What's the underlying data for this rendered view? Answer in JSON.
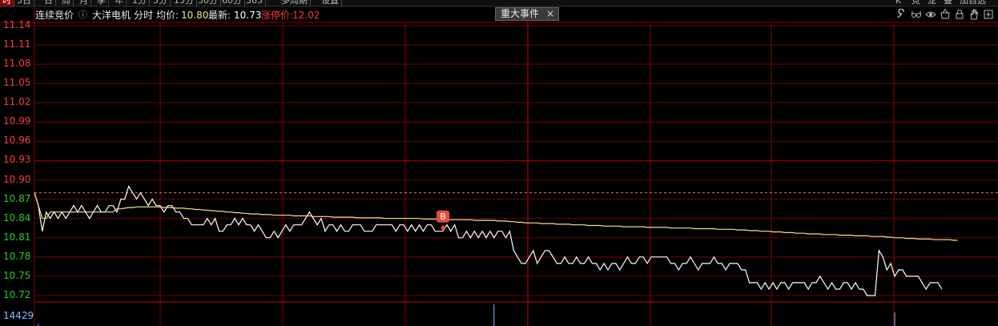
{
  "toolbar": {
    "items": [
      "时",
      "5日",
      "日",
      "周",
      "月",
      "季",
      "年",
      "1分",
      "5分",
      "15分",
      "30分",
      "60分",
      "365",
      "多周期",
      "设置"
    ],
    "active_index": 0,
    "right_items": [
      "K",
      "竞",
      "龙",
      "叠",
      "加自选"
    ]
  },
  "header": {
    "mode": "连续竞价",
    "stock_name": "大洋电机",
    "view_label": "分时",
    "avg_label": "均价:",
    "avg_value": "10.80",
    "last_label": "最新:",
    "last_value": "10.73",
    "limit_label": "涨停价:",
    "limit_value": "12.02",
    "event_tab_label": "重大事件",
    "event_tab_close": "×"
  },
  "icons": [
    "wrench-icon",
    "glasses-icon",
    "eye-icon",
    "basket-icon",
    "lock-icon",
    "hand-icon",
    "expand-icon"
  ],
  "colors": {
    "up": "#ff3b3b",
    "down": "#25d025",
    "flat": "#ffffff",
    "grid": "#8b0000",
    "price_line": "#ffffff",
    "avg_line": "#f0e68c",
    "volume": "#7ec0ff",
    "marker": "#e84b3a"
  },
  "volume_label": "14429",
  "chart_data": {
    "type": "line",
    "title": "",
    "xlabel": "",
    "ylabel": "",
    "ylim": [
      10.71,
      11.145
    ],
    "prev_close": 10.88,
    "y_ticks": [
      "11.14",
      "11.11",
      "11.08",
      "11.05",
      "11.02",
      "10.99",
      "10.96",
      "10.93",
      "10.90",
      "10.87",
      "10.84",
      "10.81",
      "10.78",
      "10.75",
      "10.72"
    ],
    "buy_marker": {
      "label": "B",
      "index": 104,
      "value": 10.825
    },
    "series": [
      {
        "values": [
          10.88,
          10.86,
          10.82,
          10.85,
          10.84,
          10.85,
          10.84,
          10.85,
          10.84,
          10.85,
          10.86,
          10.85,
          10.86,
          10.85,
          10.84,
          10.85,
          10.86,
          10.85,
          10.85,
          10.86,
          10.86,
          10.85,
          10.87,
          10.87,
          10.89,
          10.88,
          10.87,
          10.88,
          10.87,
          10.86,
          10.87,
          10.86,
          10.86,
          10.85,
          10.86,
          10.86,
          10.85,
          10.85,
          10.84,
          10.84,
          10.83,
          10.83,
          10.83,
          10.83,
          10.84,
          10.83,
          10.84,
          10.82,
          10.82,
          10.83,
          10.83,
          10.84,
          10.83,
          10.84,
          10.83,
          10.83,
          10.82,
          10.83,
          10.82,
          10.81,
          10.81,
          10.82,
          10.81,
          10.82,
          10.83,
          10.82,
          10.83,
          10.83,
          10.83,
          10.84,
          10.85,
          10.84,
          10.83,
          10.84,
          10.82,
          10.83,
          10.83,
          10.82,
          10.83,
          10.82,
          10.82,
          10.83,
          10.83,
          10.83,
          10.82,
          10.82,
          10.82,
          10.83,
          10.83,
          10.83,
          10.83,
          10.83,
          10.82,
          10.83,
          10.83,
          10.82,
          10.83,
          10.82,
          10.83,
          10.82,
          10.83,
          10.83,
          10.82,
          10.82,
          10.82,
          10.83,
          10.82,
          10.83,
          10.81,
          10.81,
          10.82,
          10.81,
          10.82,
          10.81,
          10.82,
          10.81,
          10.82,
          10.81,
          10.82,
          10.82,
          10.81,
          10.82,
          10.79,
          10.78,
          10.77,
          10.77,
          10.78,
          10.79,
          10.77,
          10.78,
          10.79,
          10.79,
          10.78,
          10.77,
          10.77,
          10.78,
          10.77,
          10.77,
          10.78,
          10.77,
          10.77,
          10.78,
          10.77,
          10.77,
          10.76,
          10.77,
          10.76,
          10.77,
          10.77,
          10.76,
          10.77,
          10.78,
          10.77,
          10.77,
          10.78,
          10.78,
          10.77,
          10.78,
          10.78,
          10.78,
          10.78,
          10.78,
          10.77,
          10.77,
          10.76,
          10.77,
          10.77,
          10.78,
          10.77,
          10.76,
          10.77,
          10.77,
          10.77,
          10.78,
          10.77,
          10.77,
          10.76,
          10.77,
          10.77,
          10.77,
          10.76,
          10.76,
          10.74,
          10.74,
          10.74,
          10.73,
          10.74,
          10.73,
          10.74,
          10.73,
          10.74,
          10.74,
          10.73,
          10.74,
          10.74,
          10.74,
          10.74,
          10.73,
          10.74,
          10.74,
          10.75,
          10.74,
          10.73,
          10.74,
          10.73,
          10.73,
          10.74,
          10.74,
          10.73,
          10.74,
          10.73,
          10.73,
          10.72,
          10.72,
          10.72,
          10.79,
          10.78,
          10.76,
          10.77,
          10.75,
          10.76,
          10.76,
          10.75,
          10.75,
          10.75,
          10.75,
          10.74,
          10.73,
          10.74,
          10.74,
          10.74,
          10.73
        ]
      },
      {
        "values": [
          10.88,
          10.86,
          10.84,
          10.84,
          10.85,
          10.85,
          10.85,
          10.85,
          10.85,
          10.85,
          10.85,
          10.85,
          10.85,
          10.85,
          10.85,
          10.85,
          10.85,
          10.85,
          10.85,
          10.85,
          10.85,
          10.855,
          10.855,
          10.856,
          10.857,
          10.857,
          10.858,
          10.858,
          10.858,
          10.858,
          10.858,
          10.858,
          10.858,
          10.857,
          10.857,
          10.857,
          10.856,
          10.856,
          10.856,
          10.855,
          10.855,
          10.854,
          10.854,
          10.853,
          10.853,
          10.852,
          10.852,
          10.851,
          10.851,
          10.85,
          10.85,
          10.849,
          10.849,
          10.848,
          10.848,
          10.847,
          10.847,
          10.847,
          10.846,
          10.846,
          10.846,
          10.845,
          10.845,
          10.845,
          10.845,
          10.845,
          10.844,
          10.844,
          10.844,
          10.844,
          10.844,
          10.843,
          10.843,
          10.843,
          10.843,
          10.843,
          10.842,
          10.842,
          10.842,
          10.842,
          10.842,
          10.842,
          10.841,
          10.841,
          10.841,
          10.841,
          10.841,
          10.841,
          10.841,
          10.84,
          10.84,
          10.84,
          10.84,
          10.84,
          10.84,
          10.84,
          10.84,
          10.84,
          10.84,
          10.839,
          10.839,
          10.839,
          10.839,
          10.839,
          10.839,
          10.838,
          10.838,
          10.838,
          10.838,
          10.838,
          10.838,
          10.838,
          10.837,
          10.837,
          10.837,
          10.837,
          10.837,
          10.837,
          10.836,
          10.836,
          10.836,
          10.835,
          10.835,
          10.834,
          10.834,
          10.833,
          10.833,
          10.833,
          10.833,
          10.832,
          10.832,
          10.832,
          10.832,
          10.831,
          10.831,
          10.831,
          10.831,
          10.83,
          10.83,
          10.83,
          10.83,
          10.829,
          10.829,
          10.829,
          10.829,
          10.828,
          10.828,
          10.828,
          10.828,
          10.828,
          10.827,
          10.827,
          10.827,
          10.827,
          10.827,
          10.827,
          10.826,
          10.826,
          10.826,
          10.826,
          10.826,
          10.826,
          10.825,
          10.825,
          10.825,
          10.825,
          10.825,
          10.825,
          10.824,
          10.824,
          10.824,
          10.824,
          10.824,
          10.824,
          10.823,
          10.823,
          10.823,
          10.823,
          10.823,
          10.822,
          10.822,
          10.822,
          10.821,
          10.821,
          10.821,
          10.82,
          10.82,
          10.82,
          10.819,
          10.819,
          10.819,
          10.818,
          10.818,
          10.818,
          10.817,
          10.817,
          10.817,
          10.816,
          10.816,
          10.816,
          10.816,
          10.815,
          10.815,
          10.815,
          10.815,
          10.814,
          10.814,
          10.814,
          10.814,
          10.813,
          10.813,
          10.813,
          10.813,
          10.812,
          10.812,
          10.812,
          10.812,
          10.811,
          10.811,
          10.81,
          10.81,
          10.81,
          10.809,
          10.809,
          10.809,
          10.808,
          10.808,
          10.808,
          10.808,
          10.807,
          10.807,
          10.807,
          10.807,
          10.807,
          10.806,
          10.806
        ]
      }
    ],
    "volume": [
      {
        "index": 1,
        "value": 1200
      },
      {
        "index": 117,
        "value": 14429
      },
      {
        "index": 219,
        "value": 9000
      }
    ]
  }
}
